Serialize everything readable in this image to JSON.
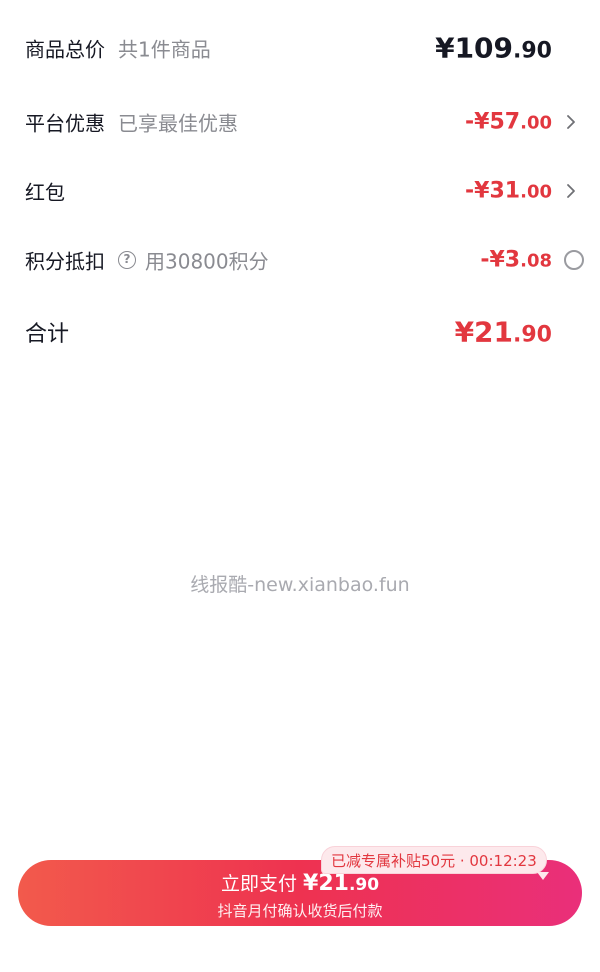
{
  "summary": {
    "items_total": {
      "label": "商品总价",
      "sub": "共1件商品",
      "currency": "¥",
      "int": "109",
      "dec": ".90"
    },
    "platform_discount": {
      "label": "平台优惠",
      "sub": "已享最佳优惠",
      "prefix": "-¥",
      "int": "57",
      "dec": ".00"
    },
    "red_packet": {
      "label": "红包",
      "prefix": "-¥",
      "int": "31",
      "dec": ".00"
    },
    "points": {
      "label": "积分抵扣",
      "help_glyph": "?",
      "sub": "用30800积分",
      "prefix": "-¥",
      "int": "3",
      "dec": ".08",
      "selected": false
    },
    "total": {
      "label": "合计",
      "currency": "¥",
      "int": "21",
      "dec": ".90"
    }
  },
  "watermark": "线报酷-new.xianbao.fun",
  "pay_button": {
    "label": "立即支付",
    "currency": "¥",
    "int": "21",
    "dec": ".90",
    "sub": "抖音月付确认收货后付款"
  },
  "promo": {
    "text": "已减专属补贴50元 · 00:12:23"
  },
  "colors": {
    "accent_red": "#e2373f",
    "text_primary": "#161823",
    "text_secondary": "#8a8b91",
    "button_gradient_start": "#f25a4c",
    "button_gradient_end": "#ea2f7a"
  },
  "icons": {
    "chevron": "chevron-right-icon",
    "help": "question-circle-icon",
    "radio": "radio-unchecked-icon"
  }
}
